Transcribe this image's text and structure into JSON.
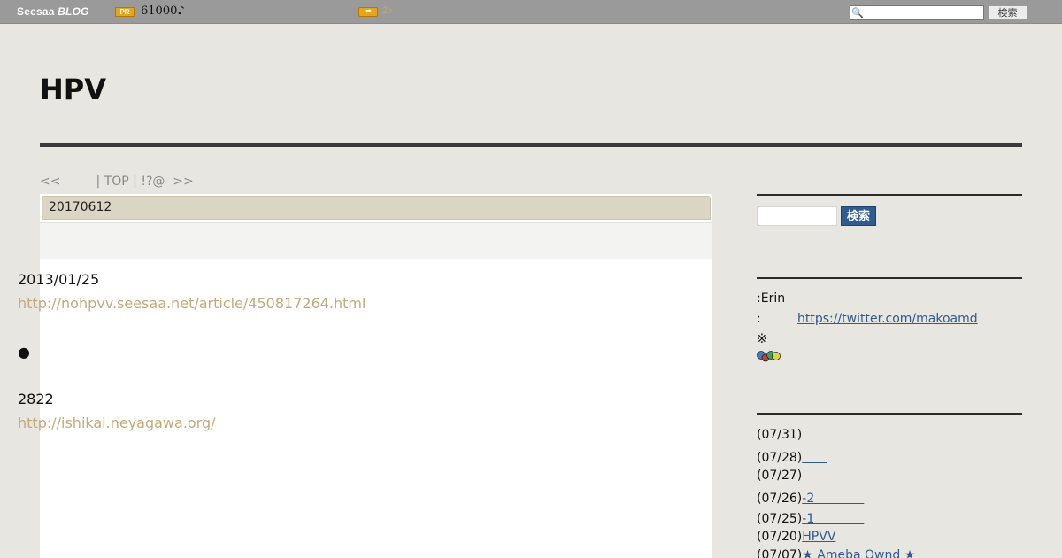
{
  "topbar": {
    "logo_seesaa": "Seesaa",
    "logo_blog": "BLOG",
    "pr_badge": "PR",
    "points": "61000♪",
    "arrow_badge": "➡",
    "count": "2♪",
    "search_placeholder": "",
    "search_button": "検索"
  },
  "header": {
    "title": "HPV"
  },
  "pager": {
    "prev": "<<",
    "top": "| TOP |",
    "mid": "!?@",
    "next": ">>"
  },
  "article": {
    "date": "20170612",
    "lines": [
      {
        "text": "2013/01/25",
        "type": "text"
      },
      {
        "text": "http://nohpvv.seesaa.net/article/450817264.html",
        "type": "link"
      },
      {
        "text": "●",
        "type": "text"
      },
      {
        "text": "2822",
        "type": "text"
      },
      {
        "text": "http://ishikai.neyagawa.org/",
        "type": "link"
      }
    ]
  },
  "sidebar": {
    "search_button": "検索",
    "profile": {
      "name_line": ":Erin",
      "twitter_prefix": ":",
      "twitter_url": "https://twitter.com/makoamd",
      "note": "※"
    },
    "recent": [
      {
        "date": "(07/31)",
        "title": ""
      },
      {
        "date": "(07/28)",
        "title": "＿＿"
      },
      {
        "date": "(07/27)",
        "title": ""
      },
      {
        "date": "(07/26)",
        "title": "-2＿＿＿＿"
      },
      {
        "date": "(07/25)",
        "title": "-1＿＿＿＿"
      },
      {
        "date": "(07/20)",
        "title": "HPVV"
      },
      {
        "date": "(07/07)",
        "title": "★ Ameba Ownd ★"
      }
    ]
  },
  "colors": {
    "topbar": "#9a9a9a",
    "background": "#e8e6e1",
    "link_article": "#c3a97a",
    "link_sidebar": "#2f5b8f",
    "date_bar": "#dad6c3"
  }
}
